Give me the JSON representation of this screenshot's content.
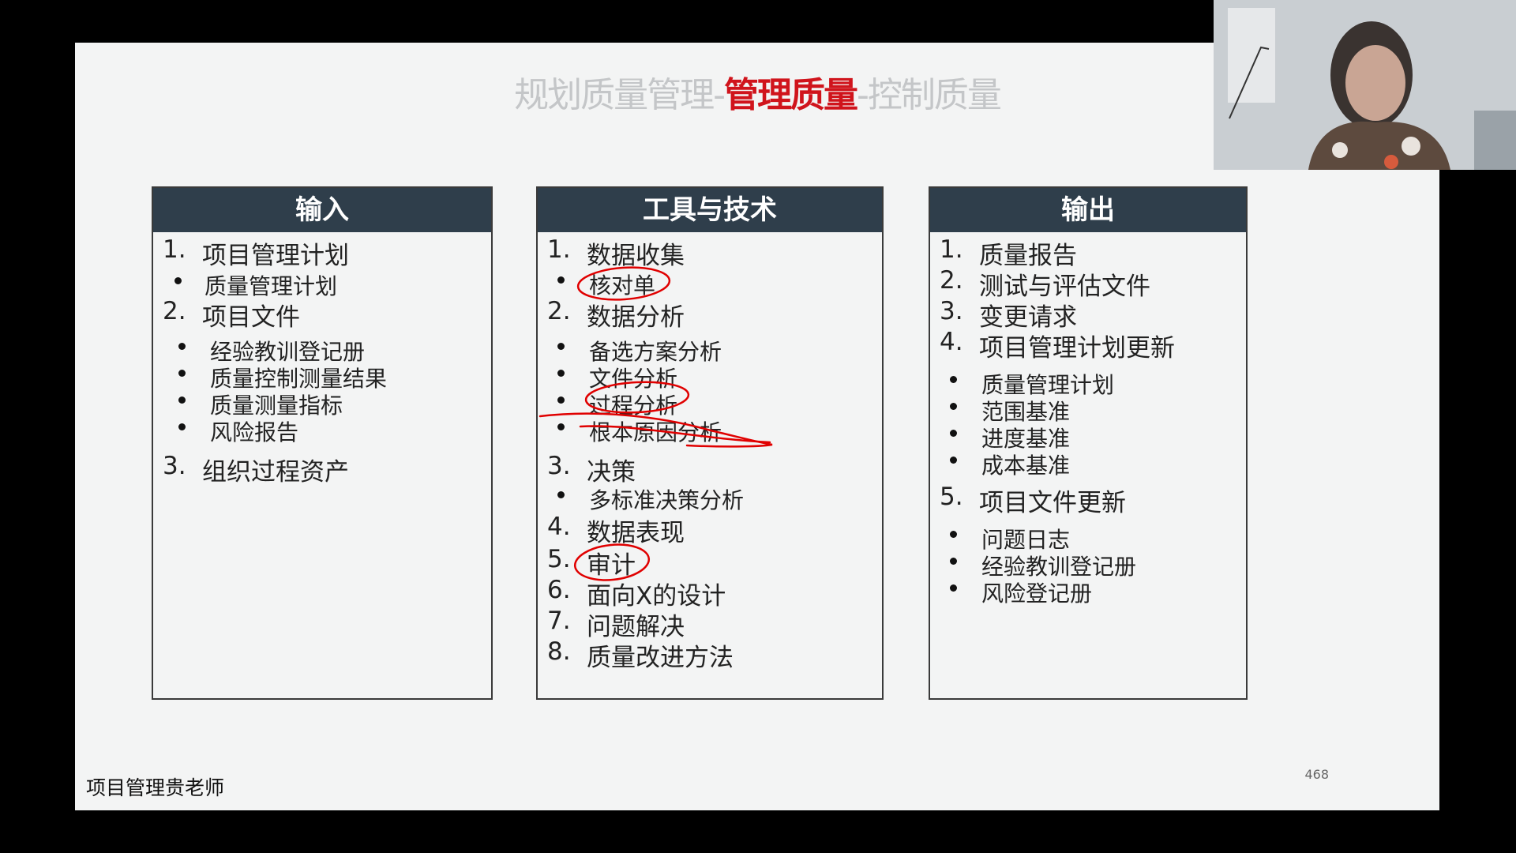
{
  "title": {
    "part1": "规划质量管理-",
    "part2": "管理质量",
    "part3": "-控制质量"
  },
  "colors": {
    "accent": "#d0141c",
    "header_bg": "#2f3e4b",
    "ink": "#e00000"
  },
  "inputs": {
    "header": "输入",
    "items": [
      {
        "num": "1.",
        "label": "项目管理计划"
      },
      {
        "bullet": "质量管理计划"
      },
      {
        "num": "2.",
        "label": "项目文件"
      },
      {
        "bullet": "经验教训登记册"
      },
      {
        "bullet": "质量控制测量结果"
      },
      {
        "bullet": "质量测量指标"
      },
      {
        "bullet": "风险报告"
      },
      {
        "num": "3.",
        "label": "组织过程资产"
      }
    ]
  },
  "tools": {
    "header": "工具与技术",
    "items": [
      {
        "num": "1.",
        "label": "数据收集"
      },
      {
        "bullet": "核对单"
      },
      {
        "num": "2.",
        "label": "数据分析"
      },
      {
        "bullet": "备选方案分析"
      },
      {
        "bullet": "文件分析"
      },
      {
        "bullet": "过程分析"
      },
      {
        "bullet": "根本原因分析"
      },
      {
        "num": "3.",
        "label": "决策"
      },
      {
        "bullet": "多标准决策分析"
      },
      {
        "num": "4.",
        "label": "数据表现"
      },
      {
        "num": "5.",
        "label": "审计"
      },
      {
        "num": "6.",
        "label": "面向X的设计"
      },
      {
        "num": "7.",
        "label": "问题解决"
      },
      {
        "num": "8.",
        "label": "质量改进方法"
      }
    ]
  },
  "outputs": {
    "header": "输出",
    "items": [
      {
        "num": "1.",
        "label": "质量报告"
      },
      {
        "num": "2.",
        "label": "测试与评估文件"
      },
      {
        "num": "3.",
        "label": "变更请求"
      },
      {
        "num": "4.",
        "label": "项目管理计划更新"
      },
      {
        "bullet": "质量管理计划"
      },
      {
        "bullet": "范围基准"
      },
      {
        "bullet": "进度基准"
      },
      {
        "bullet": "成本基准"
      },
      {
        "num": "5.",
        "label": "项目文件更新"
      },
      {
        "bullet": "问题日志"
      },
      {
        "bullet": "经验教训登记册"
      },
      {
        "bullet": "风险登记册"
      }
    ]
  },
  "footer": "项目管理贵老师",
  "page_number": "468"
}
